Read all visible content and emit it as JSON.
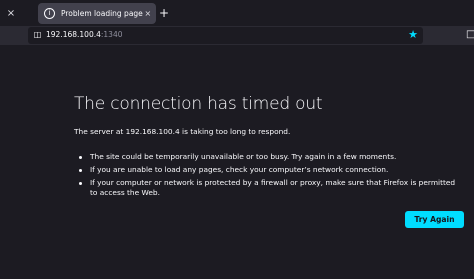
{
  "browser": {
    "tabs": [
      {
        "title": "Problem loading page",
        "close_glyph": "×",
        "icon": "info-icon"
      }
    ],
    "close_glyph_left": "×",
    "new_tab_glyph": "+",
    "url_host": "192.168.100.4",
    "url_port": ":1340",
    "bookmark_icon": "star-icon",
    "accent_color": "#00ddff"
  },
  "error_page": {
    "title": "The connection has timed out",
    "intro": "The server at 192.168.100.4 is taking too long to respond.",
    "reasons": [
      "The site could be temporarily unavailable or too busy. Try again in a few moments.",
      "If you are unable to load any pages, check your computer’s network connection.",
      "If your computer or network is protected by a firewall or proxy, make sure that Firefox is permitted to access the Web."
    ],
    "try_again_label": "Try Again"
  }
}
